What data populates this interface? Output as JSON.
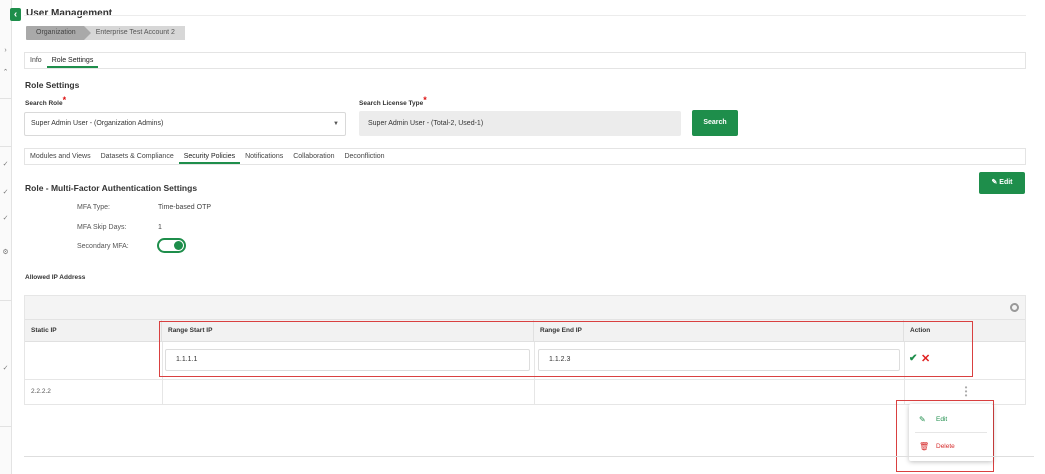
{
  "page": {
    "title": "User Management"
  },
  "breadcrumb": {
    "items": [
      "Organization",
      "Enterprise Test Account 2"
    ]
  },
  "top_tabs": [
    "Info",
    "Role Settings"
  ],
  "role_settings": {
    "heading": "Role Settings",
    "search_role_label": "Search Role",
    "search_role_value": "Super Admin User - (Organization Admins)",
    "search_license_label": "Search License Type",
    "search_license_value": "Super Admin User - (Total-2, Used-1)",
    "search_button": "Search"
  },
  "sub_tabs": [
    "Modules and Views",
    "Datasets & Compliance",
    "Security Policies",
    "Notifications",
    "Collaboration",
    "Deconfliction"
  ],
  "mfa": {
    "heading": "Role - Multi-Factor Authentication Settings",
    "edit_button": "Edit",
    "type_label": "MFA Type:",
    "type_value": "Time-based OTP",
    "skip_days_label": "MFA Skip Days:",
    "skip_days_value": "1",
    "secondary_label": "Secondary MFA:",
    "secondary_enabled": true
  },
  "allowed_ip": {
    "heading": "Allowed IP Address",
    "columns": [
      "Static IP",
      "Range Start IP",
      "Range End IP",
      "Action"
    ],
    "editing_row": {
      "static_ip": "",
      "range_start": "1.1.1.1",
      "range_end": "1.1.2.3"
    },
    "rows": [
      {
        "static_ip": "2.2.2.2",
        "range_start": "",
        "range_end": ""
      }
    ]
  },
  "context_menu": {
    "edit_label": "Edit",
    "delete_label": "Delete"
  },
  "colors": {
    "accent": "#1e8e4b",
    "danger": "#d62b2b",
    "highlight": "#d94040"
  }
}
